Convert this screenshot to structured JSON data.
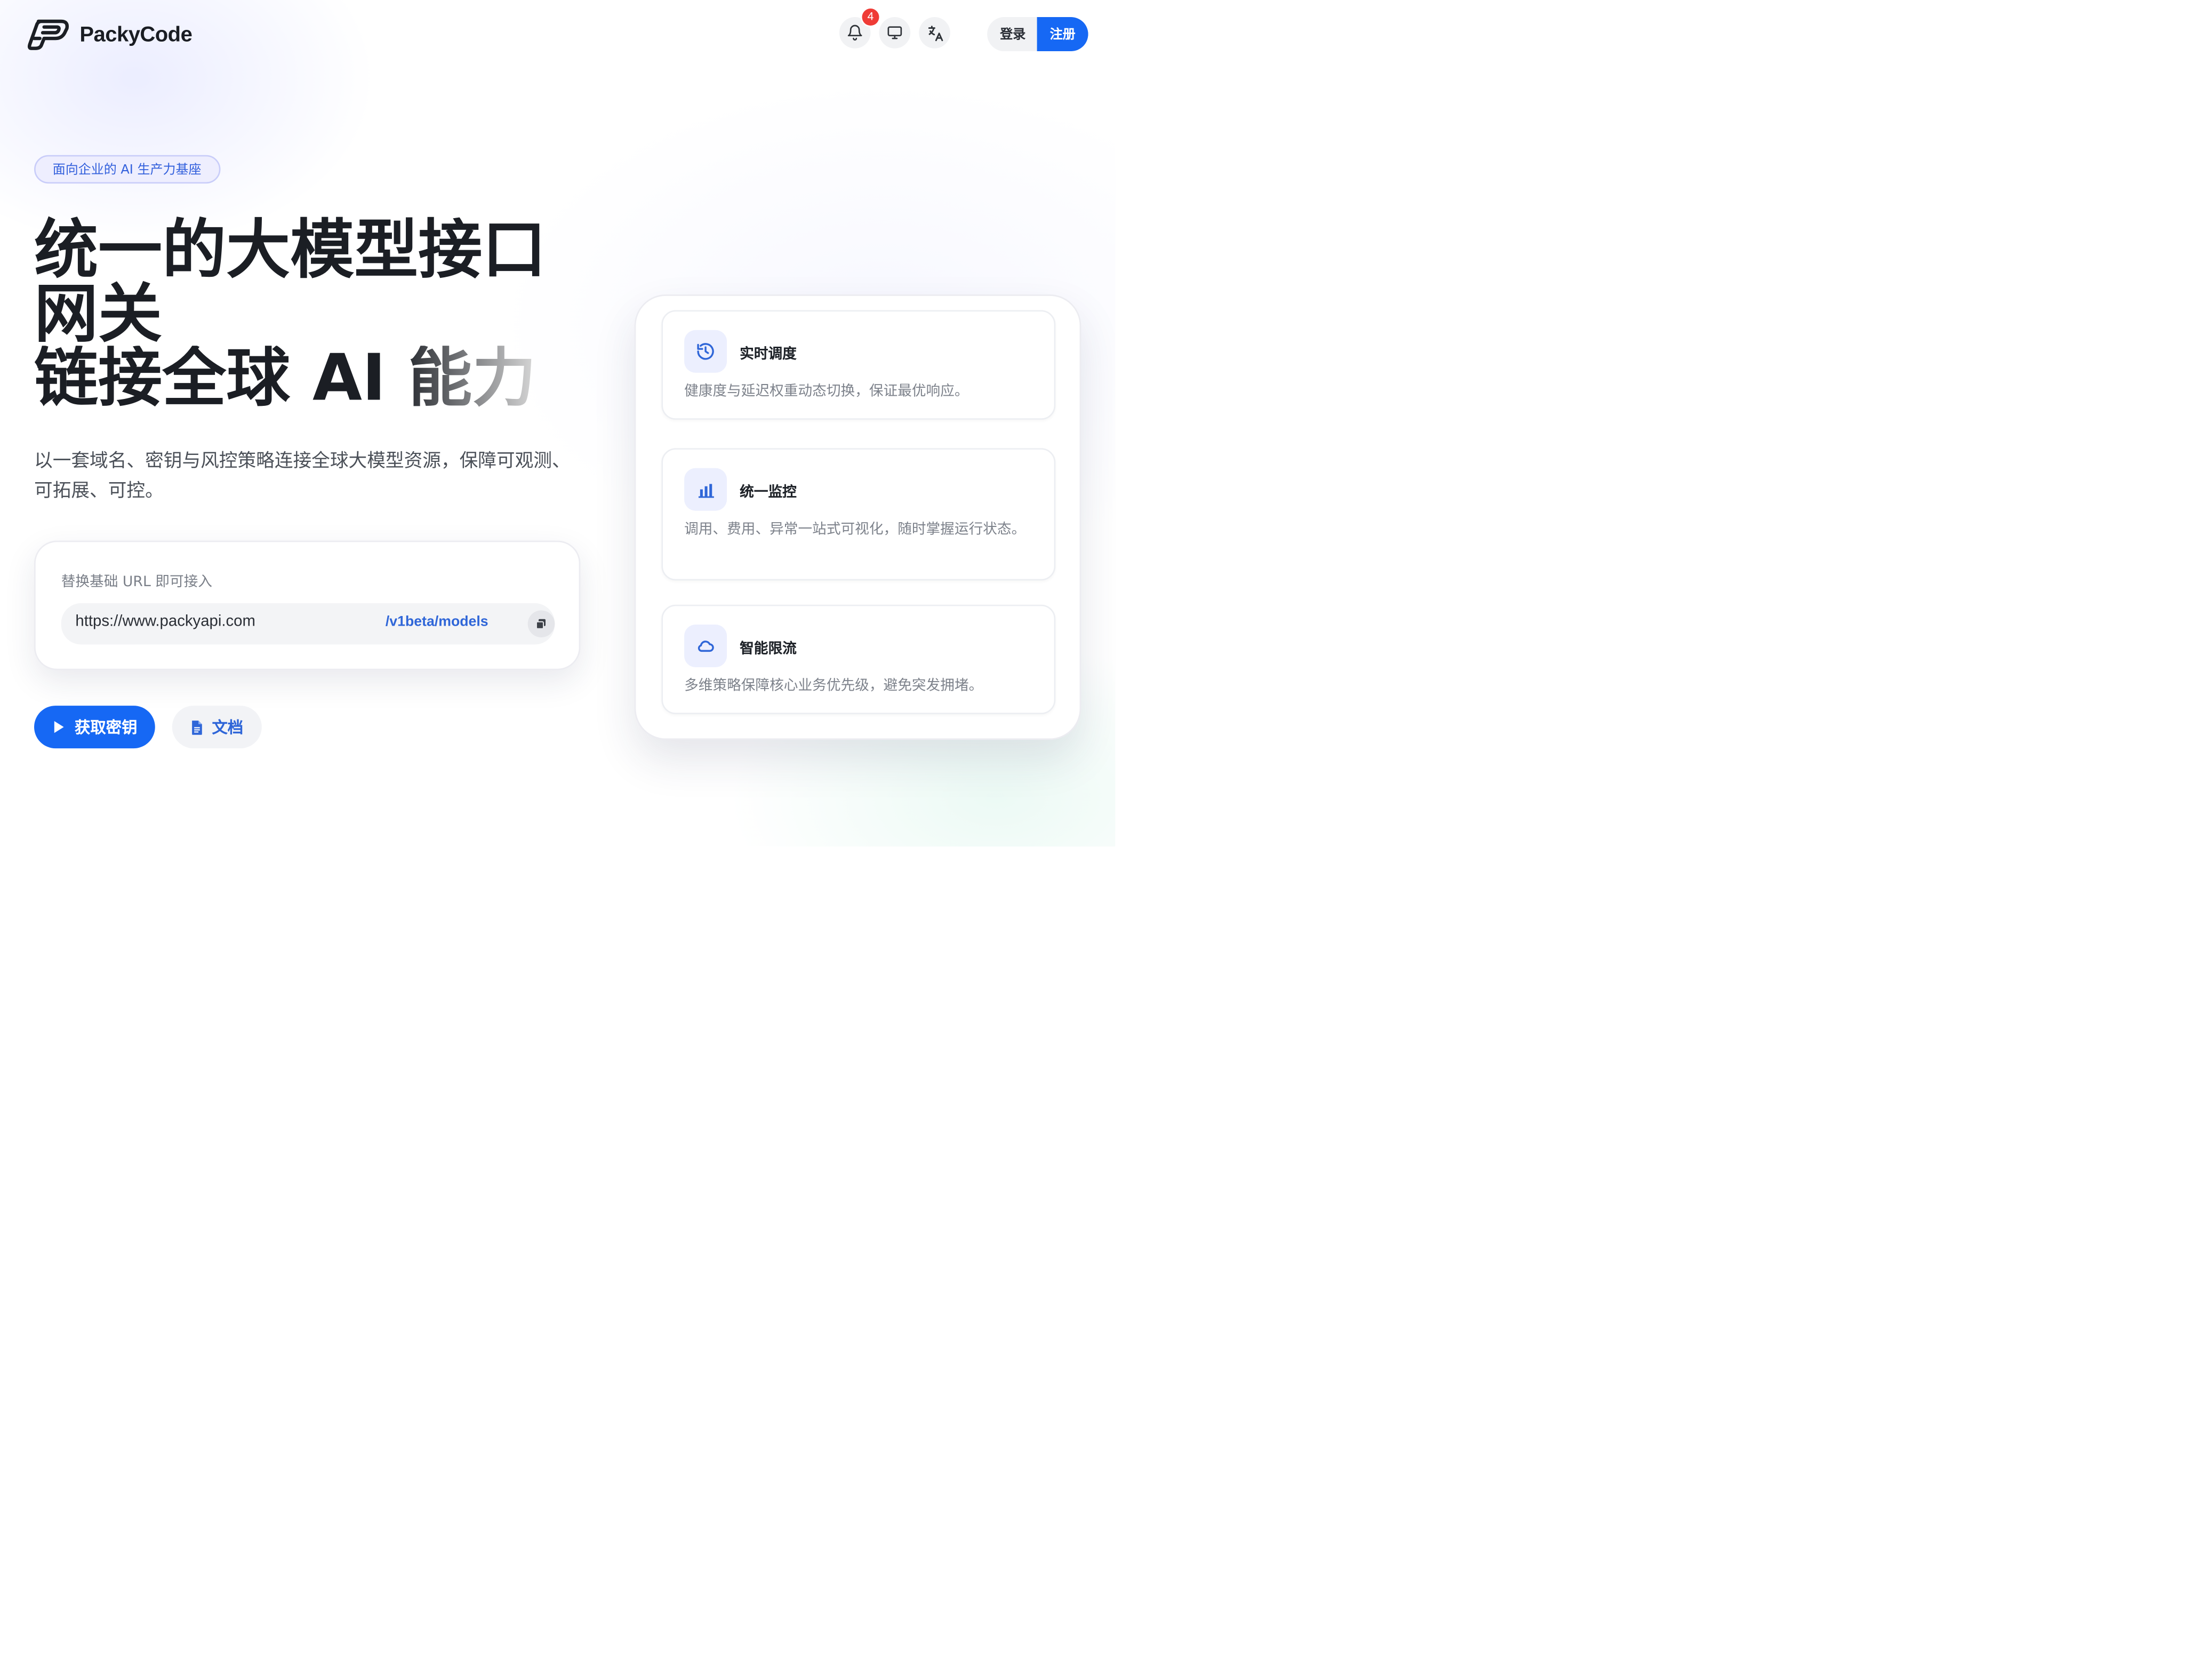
{
  "header": {
    "brand_name": "PackyCode",
    "icons": [
      "bell-icon",
      "monitor-icon",
      "translate-icon"
    ],
    "notification_count": "4",
    "login_label": "登录",
    "register_label": "注册"
  },
  "hero": {
    "tagline": "面向企业的 AI 生产力基座",
    "title_line_1": "统一的大模型接口",
    "title_line_2": "网关",
    "title_line_3": "链接全球 AI 能力",
    "subtitle": "以一套域名、密钥与风控策略连接全球大模型资源，保障可观测、可拓展、可控。"
  },
  "url_box": {
    "label": "替换基础 URL 即可接入",
    "base_url": "https://www.packyapi.com",
    "path": "/v1beta/models",
    "copy_icon": "copy-icon"
  },
  "actions": {
    "primary_label": "获取密钥",
    "secondary_label": "文档",
    "primary_icon": "play-icon",
    "secondary_icon": "document-icon"
  },
  "features": [
    {
      "title": "实时调度",
      "description": "健康度与延迟权重动态切换，保证最优响应。",
      "icon": "history-icon"
    },
    {
      "title": "统一监控",
      "description": "调用、费用、异常一站式可视化，随时掌握运行状态。",
      "icon": "bar-chart-icon"
    },
    {
      "title": "智能限流",
      "description": "多维策略保障核心业务优先级，避免突发拥堵。",
      "icon": "cloud-icon"
    }
  ],
  "colors": {
    "primary": "#1668f4",
    "tag_background": "#eeeefe",
    "text_dark": "#1b1e24",
    "badge": "#ef3b36"
  }
}
